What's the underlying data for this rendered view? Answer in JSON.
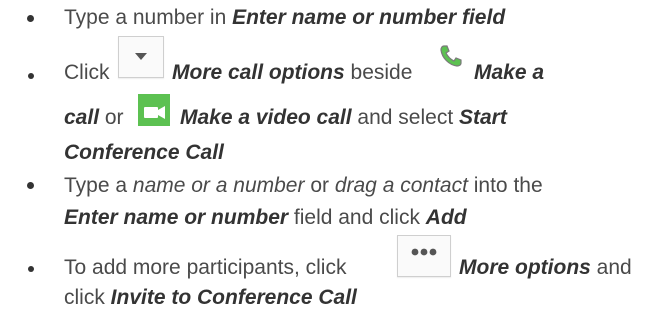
{
  "bullets": [
    {
      "pre": "Type a number in ",
      "bold": "Enter name or number field"
    },
    {
      "click": "Click ",
      "more_call_options": "More call options",
      "beside": " beside ",
      "make_a": "Make a",
      "call": "call",
      "or": " or ",
      "make_video_call": "Make a video call",
      "and_select": " and select ",
      "start": "Start",
      "conference_call": "Conference Call"
    },
    {
      "type_a": "Type a ",
      "name_or_number": "name or a number",
      "or": " or ",
      "drag_contact": "drag a contact",
      "into_the": " into the",
      "enter_name": "Enter name or number",
      "field_click": " field and click ",
      "add": "Add"
    },
    {
      "pre": "To add more participants, click ",
      "more_options": "More options",
      "and": " and",
      "click": "click ",
      "invite": "Invite to Conference Call"
    }
  ],
  "icons": {
    "dropdown": "chevron-down-icon",
    "call": "phone-icon",
    "video": "video-camera-icon",
    "more": "ellipsis-icon"
  },
  "colors": {
    "green": "#5cc151",
    "text": "#4a4a4a",
    "bold": "#333333"
  }
}
